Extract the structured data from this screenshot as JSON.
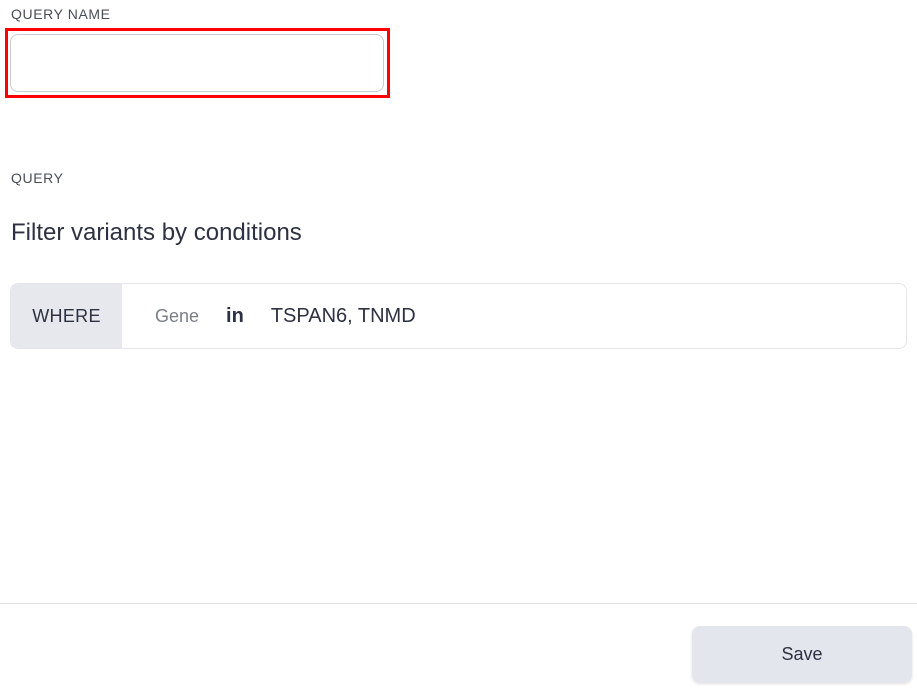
{
  "form": {
    "query_name_label": "QUERY NAME",
    "query_name_value": "",
    "query_label": "QUERY",
    "section_title": "Filter variants by conditions"
  },
  "condition": {
    "keyword": "WHERE",
    "field": "Gene",
    "operator": "in",
    "values": "TSPAN6, TNMD"
  },
  "footer": {
    "save_label": "Save"
  },
  "colors": {
    "highlight": "#ff0000",
    "keyword_bg": "#e6e8ed",
    "button_bg": "#e3e6ec"
  }
}
